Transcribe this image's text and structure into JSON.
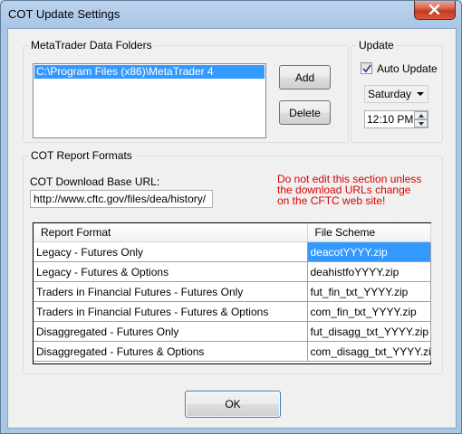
{
  "window": {
    "title": "COT Update Settings"
  },
  "folders": {
    "group_label": "MetaTrader Data Folders",
    "items": [
      "C:\\Program Files (x86)\\MetaTrader 4"
    ],
    "add_label": "Add",
    "delete_label": "Delete"
  },
  "update": {
    "group_label": "Update",
    "auto_update_label": "Auto Update",
    "auto_update_checked": true,
    "day_value": "Saturday",
    "time_value": "12:10 PM"
  },
  "formats": {
    "group_label": "COT Report Formats",
    "base_url_label": "COT Download Base URL:",
    "base_url_value": "http://www.cftc.gov/files/dea/history/",
    "warning_lines": [
      "Do not edit this section unless",
      "the download URLs change",
      "on the CFTC web site!"
    ],
    "columns": [
      "Report Format",
      "File Scheme"
    ],
    "rows": [
      [
        "Legacy - Futures Only",
        "deacotYYYY.zip"
      ],
      [
        "Legacy - Futures & Options",
        "deahistfoYYYY.zip"
      ],
      [
        "Traders in Financial Futures - Futures Only",
        "fut_fin_txt_YYYY.zip"
      ],
      [
        "Traders in Financial Futures - Futures & Options",
        "com_fin_txt_YYYY.zip"
      ],
      [
        "Disaggregated - Futures Only",
        "fut_disagg_txt_YYYY.zip"
      ],
      [
        "Disaggregated - Futures & Options",
        "com_disagg_txt_YYYY.zip"
      ]
    ]
  },
  "footer": {
    "ok_label": "OK"
  },
  "colors": {
    "selection": "#3399ff",
    "warning": "#e00000",
    "close_button": "#c23a22"
  }
}
